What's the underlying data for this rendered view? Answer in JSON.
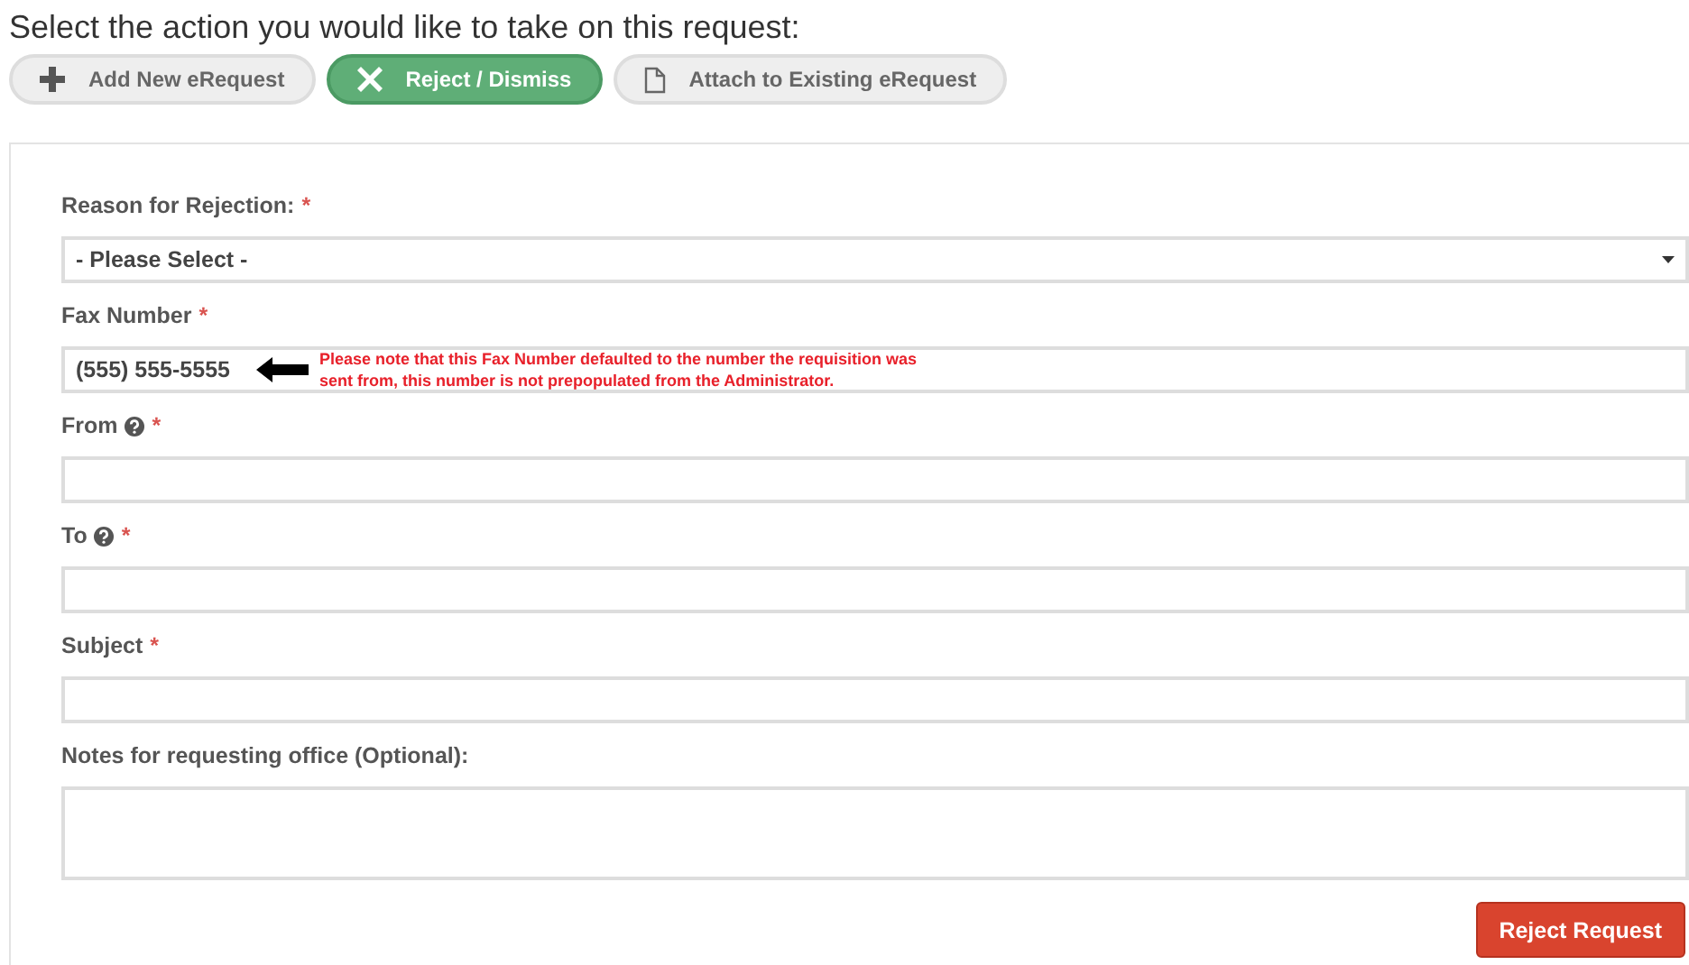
{
  "prompt": "Select the action you would like to take on this request:",
  "actions": [
    {
      "label": "Add New eRequest",
      "selected": false
    },
    {
      "label": "Reject / Dismiss",
      "selected": true
    },
    {
      "label": "Attach to Existing eRequest",
      "selected": false
    }
  ],
  "fields": [
    {
      "kind": "select",
      "label": "Reason for Rejection:",
      "help": false,
      "required_mark": "*",
      "value": "- Please Select -"
    },
    {
      "kind": "text",
      "label": "Fax Number",
      "help": false,
      "required_mark": "*",
      "value": "(555) 555-5555",
      "note": "Please note that this Fax Number defaulted to the number the requisition was sent from, this number is not prepopulated from the Administrator."
    },
    {
      "kind": "text",
      "label": "From",
      "help": true,
      "required_mark": "*"
    },
    {
      "kind": "text",
      "label": "To",
      "help": true,
      "required_mark": "*"
    },
    {
      "kind": "text",
      "label": "Subject",
      "help": false,
      "required_mark": "*"
    },
    {
      "kind": "textarea",
      "label": "Notes for requesting office (Optional):",
      "help": false
    }
  ],
  "submit": "Reject Request"
}
